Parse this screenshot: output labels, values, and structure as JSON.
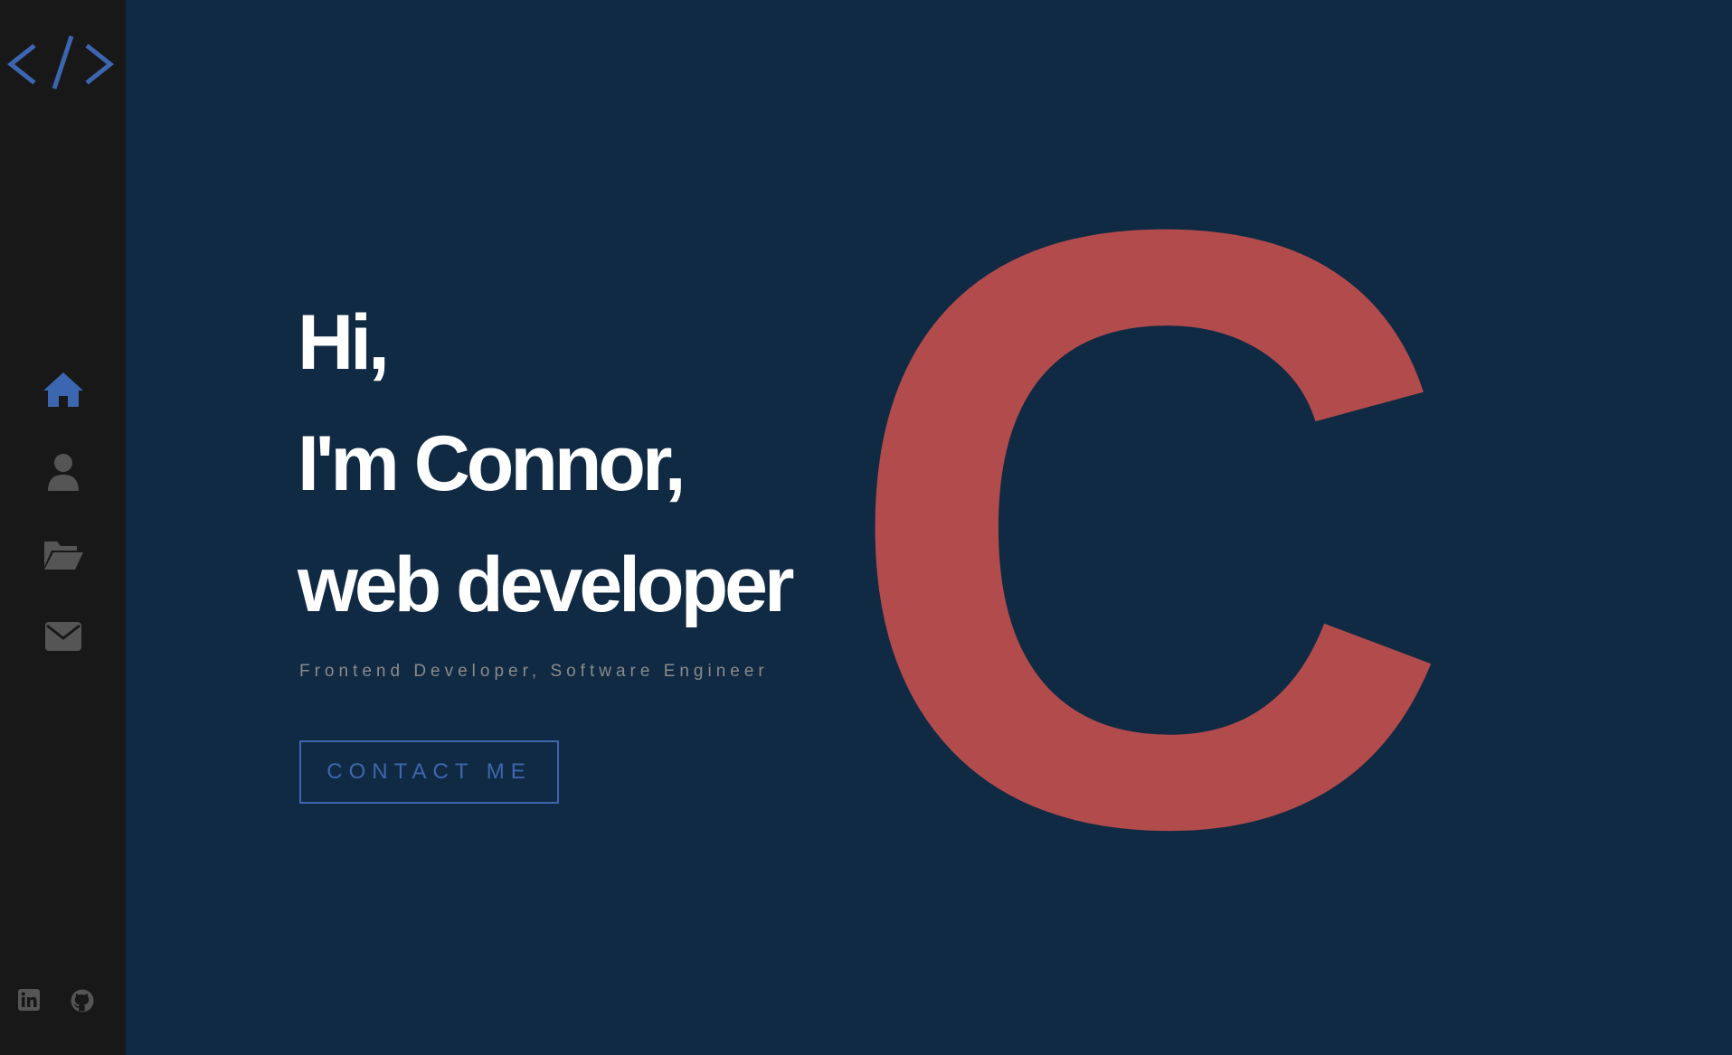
{
  "sidebar": {
    "logo_icon": "code-brackets-icon",
    "nav_items": [
      {
        "icon": "home-icon",
        "active": true
      },
      {
        "icon": "user-icon",
        "active": false
      },
      {
        "icon": "folder-open-icon",
        "active": false
      },
      {
        "icon": "envelope-icon",
        "active": false
      }
    ],
    "social_icons": [
      "linkedin-icon",
      "github-icon"
    ]
  },
  "hero": {
    "line1": "Hi,",
    "line2": "I'm Connor,",
    "line3": "web developer",
    "subtitle": "Frontend Developer, Software Engineer",
    "cta_label": "CONTACT ME",
    "decorative_letter": "C"
  },
  "colors": {
    "background": "#112a43",
    "sidebar": "#181818",
    "accent": "#3d66b0",
    "letter": "#b24c4c",
    "inactive_icon": "#555555",
    "headline": "#ffffff",
    "subtitle": "#8a8a8a"
  }
}
